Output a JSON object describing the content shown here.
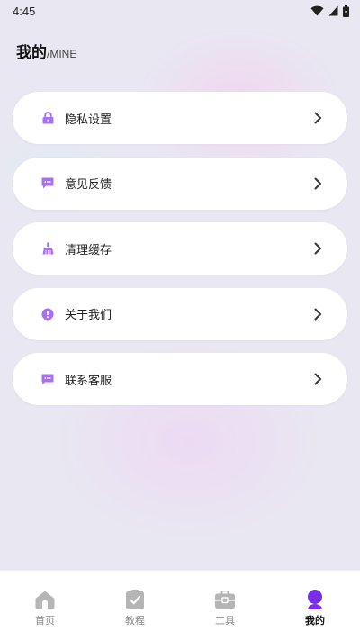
{
  "status_bar": {
    "time": "4:45",
    "icons": [
      "wifi-icon",
      "signal-icon",
      "battery-icon"
    ]
  },
  "header": {
    "title": "我的",
    "subtitle": "/MINE"
  },
  "menu": {
    "items": [
      {
        "label": "隐私设置",
        "icon": "lock-icon"
      },
      {
        "label": "意见反馈",
        "icon": "chat-bubble-icon"
      },
      {
        "label": "清理缓存",
        "icon": "broom-icon"
      },
      {
        "label": "关于我们",
        "icon": "info-alert-icon"
      },
      {
        "label": "联系客服",
        "icon": "message-icon"
      }
    ],
    "chevron_icon": "chevron-right-icon"
  },
  "bottom_nav": {
    "items": [
      {
        "label": "首页",
        "icon": "home-icon",
        "active": false
      },
      {
        "label": "教程",
        "icon": "checkbox-icon",
        "active": false
      },
      {
        "label": "工具",
        "icon": "toolbox-icon",
        "active": false
      },
      {
        "label": "我的",
        "icon": "person-icon",
        "active": true
      }
    ]
  },
  "colors": {
    "accent": "#a970f0",
    "active_nav": "#7a2ee8",
    "inactive_nav": "#b5b5b5",
    "background": "#e9e7f2"
  }
}
